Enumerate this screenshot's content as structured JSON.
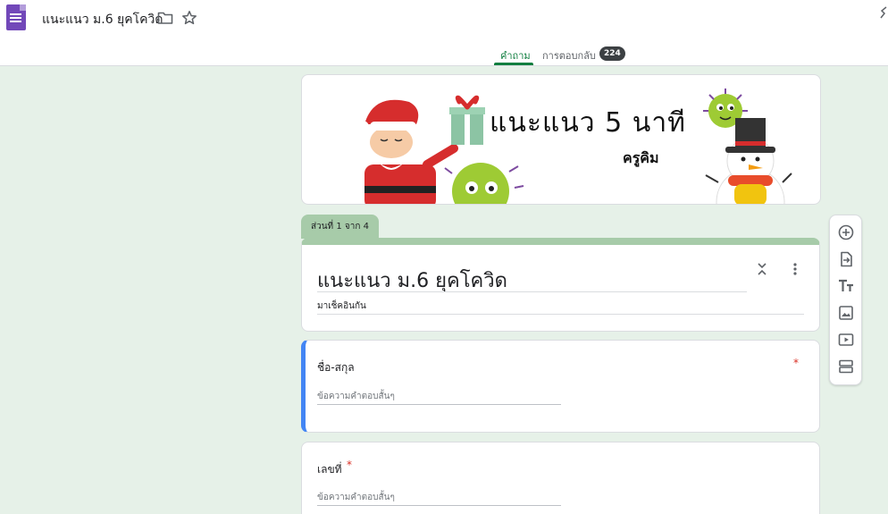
{
  "header": {
    "title": "แนะแนว ม.6 ยุคโควิด",
    "tabs": {
      "questions": "คำถาม",
      "responses": "การตอบกลับ",
      "responses_count": "224"
    }
  },
  "banner": {
    "title": "แนะแนว 5 นาที",
    "subtitle": "ครูคิม"
  },
  "section": {
    "label": "ส่วนที่ 1 จาก 4"
  },
  "form": {
    "title": "แนะแนว ม.6 ยุคโควิด",
    "description": "มาเช็คอินกัน"
  },
  "questions": [
    {
      "label": "ชื่อ-สกุล",
      "required_mark": "*",
      "placeholder": "ข้อความคำตอบสั้นๆ"
    },
    {
      "label": "เลขที่",
      "required_mark": "*",
      "placeholder": "ข้อความคำตอบสั้นๆ"
    }
  ],
  "colors": {
    "accent": "#0f7e3f",
    "theme": "#a7cba9",
    "background": "#e6f1e8",
    "active_border": "#4285f4",
    "required": "#d93025"
  },
  "icons": {
    "logo": "forms-logo-icon",
    "folder": "folder-icon",
    "star": "star-icon",
    "collapse": "collapse-icon",
    "more": "more-vert-icon",
    "toolbar": [
      "add-question-icon",
      "import-questions-icon",
      "add-title-icon",
      "add-image-icon",
      "add-video-icon",
      "add-section-icon"
    ]
  }
}
